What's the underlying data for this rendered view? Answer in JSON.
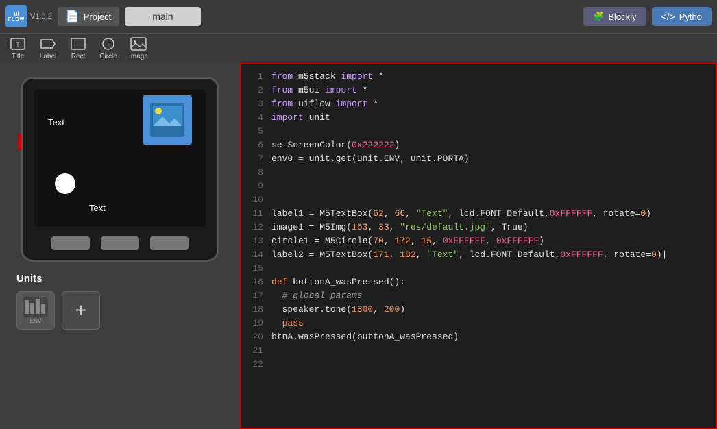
{
  "app": {
    "logo_line1": "ui",
    "logo_line2": "FLOW",
    "version": "V1.3.2",
    "project_label": "Project",
    "main_tab": "main",
    "blockly_label": "Blockly",
    "python_label": "Pytho"
  },
  "toolbar": {
    "items": [
      {
        "label": "Title",
        "icon": "T"
      },
      {
        "label": "Label",
        "icon": "Aa"
      },
      {
        "label": "Rect",
        "icon": "☐"
      },
      {
        "label": "Circle",
        "icon": "○"
      },
      {
        "label": "Image",
        "icon": "🖼"
      }
    ]
  },
  "device": {
    "text_top": "Text",
    "text_bottom": "Text"
  },
  "units": {
    "title": "Units",
    "add_label": "+"
  },
  "code": {
    "lines": [
      {
        "num": 1,
        "text": "from m5stack import *"
      },
      {
        "num": 2,
        "text": "from m5ui import *"
      },
      {
        "num": 3,
        "text": "from uiflow import *"
      },
      {
        "num": 4,
        "text": "import unit"
      },
      {
        "num": 5,
        "text": ""
      },
      {
        "num": 6,
        "text": "setScreenColor(0x222222)"
      },
      {
        "num": 7,
        "text": "env0 = unit.get(unit.ENV, unit.PORTA)"
      },
      {
        "num": 8,
        "text": ""
      },
      {
        "num": 9,
        "text": ""
      },
      {
        "num": 10,
        "text": ""
      },
      {
        "num": 11,
        "text": "label1 = M5TextBox(62, 66, \"Text\", lcd.FONT_Default,0xFFFFFF, rotate=0)"
      },
      {
        "num": 12,
        "text": "image1 = M5Img(163, 33, \"res/default.jpg\", True)"
      },
      {
        "num": 13,
        "text": "circle1 = M5Circle(70, 172, 15, 0xFFFFFF, 0xFFFFFF)"
      },
      {
        "num": 14,
        "text": "label2 = M5TextBox(171, 182, \"Text\", lcd.FONT_Default,0xFFFFFF, rotate=0)"
      },
      {
        "num": 15,
        "text": ""
      },
      {
        "num": 16,
        "text": "def buttonA_wasPressed():"
      },
      {
        "num": 17,
        "text": "  # global params"
      },
      {
        "num": 18,
        "text": "  speaker.tone(1800, 200)"
      },
      {
        "num": 19,
        "text": "  pass"
      },
      {
        "num": 20,
        "text": "btnA.wasPressed(buttonA_wasPressed)"
      },
      {
        "num": 21,
        "text": ""
      },
      {
        "num": 22,
        "text": ""
      }
    ]
  }
}
